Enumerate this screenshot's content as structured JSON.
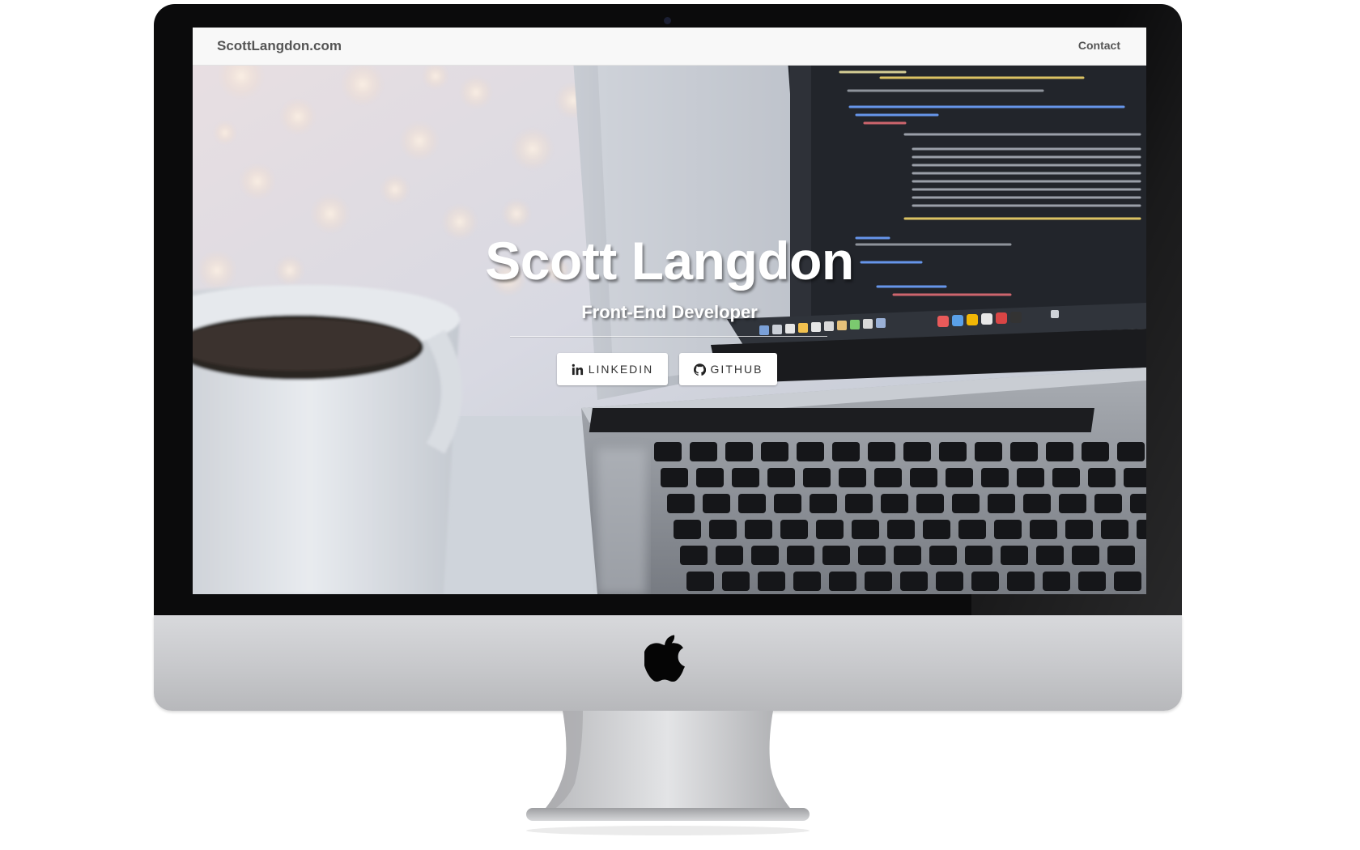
{
  "navbar": {
    "brand": "ScottLangdon.com",
    "links": [
      "Contact"
    ]
  },
  "hero": {
    "title": "Scott Langdon",
    "subtitle": "Front-End Developer",
    "buttons": [
      {
        "label": "LINKEDIN",
        "icon": "linkedin-icon"
      },
      {
        "label": "GITHUB",
        "icon": "github-icon"
      }
    ]
  },
  "colors": {
    "navbar_bg": "#f8f8f8",
    "navbar_text": "#555555",
    "hero_text": "#ffffff",
    "button_bg": "#ffffff",
    "button_text": "#333333",
    "bezel": "#0b0b0c",
    "chin": "#c7c8cb"
  }
}
